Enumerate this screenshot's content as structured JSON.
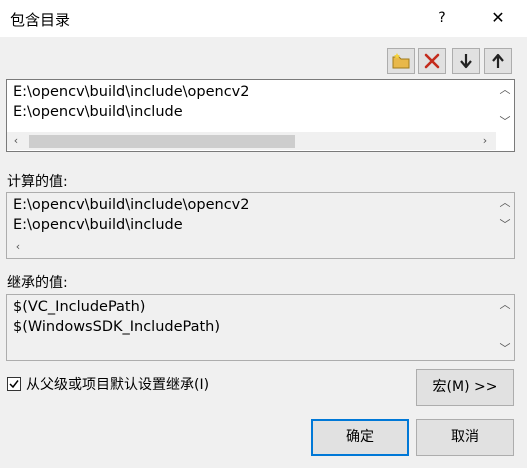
{
  "window": {
    "title": "包含目录",
    "help_label": "?",
    "close_label": "✕"
  },
  "toolbar": {
    "buttons": [
      {
        "name": "new-line-icon",
        "label": "New line"
      },
      {
        "name": "delete-icon",
        "label": "Delete"
      },
      {
        "name": "move-down-icon",
        "label": "Move down"
      },
      {
        "name": "move-up-icon",
        "label": "Move up"
      }
    ]
  },
  "edit_list": {
    "lines": [
      "E:\\opencv\\build\\include\\opencv2",
      "E:\\opencv\\build\\include"
    ]
  },
  "computed": {
    "label": "计算的值:",
    "lines": [
      "E:\\opencv\\build\\include\\opencv2",
      "E:\\opencv\\build\\include"
    ]
  },
  "inherited": {
    "label": "继承的值:",
    "lines": [
      "$(VC_IncludePath)",
      "$(WindowsSDK_IncludePath)"
    ]
  },
  "inherit_checkbox": {
    "label": "从父级或项目默认设置继承(I)",
    "checked": true
  },
  "buttons": {
    "macro": "宏(M) >>",
    "ok": "确定",
    "cancel": "取消"
  },
  "colors": {
    "accent": "#0078d7",
    "delete_red": "#c42b1c",
    "folder_yellow": "#e8b84a"
  }
}
